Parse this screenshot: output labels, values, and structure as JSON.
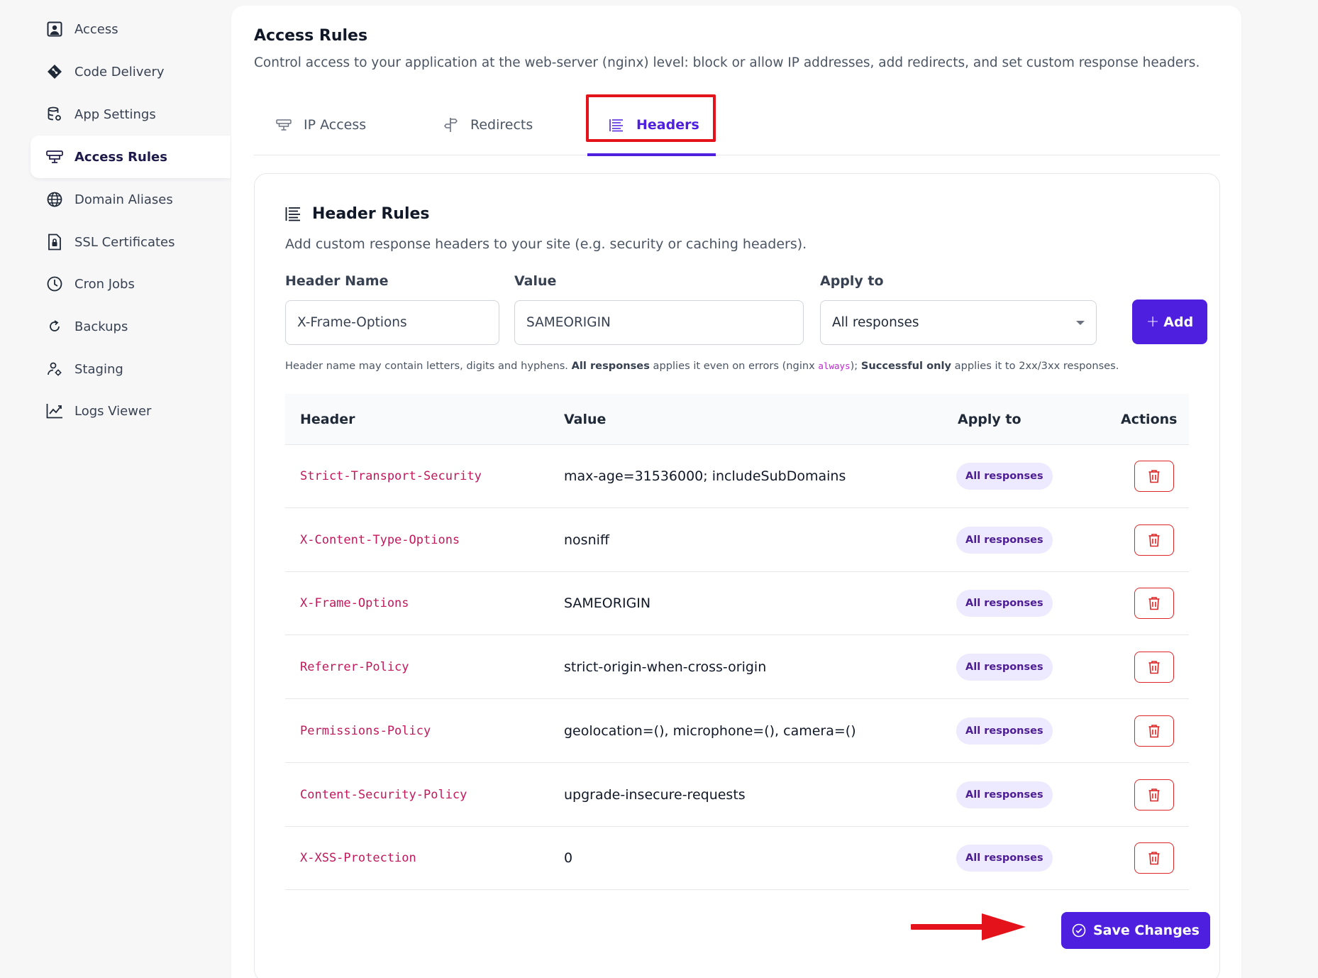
{
  "sidebar": {
    "items": [
      {
        "label": "Access",
        "icon": "user-square-icon"
      },
      {
        "label": "Code Delivery",
        "icon": "git-diamond-icon"
      },
      {
        "label": "App Settings",
        "icon": "database-gear-icon"
      },
      {
        "label": "Access Rules",
        "icon": "filter-rules-icon",
        "active": true
      },
      {
        "label": "Domain Aliases",
        "icon": "globe-icon"
      },
      {
        "label": "SSL Certificates",
        "icon": "lock-file-icon"
      },
      {
        "label": "Cron Jobs",
        "icon": "clock-icon"
      },
      {
        "label": "Backups",
        "icon": "refresh-icon"
      },
      {
        "label": "Staging",
        "icon": "user-gear-icon"
      },
      {
        "label": "Logs Viewer",
        "icon": "chart-line-icon"
      }
    ]
  },
  "page": {
    "title": "Access Rules",
    "subtitle": "Control access to your application at the web-server (nginx) level: block or allow IP addresses, add redirects, and set custom response headers."
  },
  "tabs": [
    {
      "label": "IP Access",
      "icon": "filter-icon"
    },
    {
      "label": "Redirects",
      "icon": "signpost-icon"
    },
    {
      "label": "Headers",
      "icon": "list-icon",
      "active": true
    }
  ],
  "card": {
    "title": "Header Rules",
    "subtitle": "Add custom response headers to your site (e.g. security or caching headers)."
  },
  "form": {
    "name_label": "Header Name",
    "name_value": "X-Frame-Options",
    "value_label": "Value",
    "value_value": "SAMEORIGIN",
    "apply_label": "Apply to",
    "apply_selected": "All responses",
    "add_label": "Add",
    "hint": {
      "part1": "Header name may contain letters, digits and hyphens. ",
      "bold1": "All responses",
      "part2": " applies it even on errors (nginx ",
      "code": "always",
      "part3": "); ",
      "bold2": "Successful only",
      "part4": " applies it to 2xx/3xx responses."
    }
  },
  "table": {
    "columns": [
      "Header",
      "Value",
      "Apply to",
      "Actions"
    ],
    "rows": [
      {
        "header": "Strict-Transport-Security",
        "value": "max-age=31536000; includeSubDomains",
        "apply": "All responses"
      },
      {
        "header": "X-Content-Type-Options",
        "value": "nosniff",
        "apply": "All responses"
      },
      {
        "header": "X-Frame-Options",
        "value": "SAMEORIGIN",
        "apply": "All responses"
      },
      {
        "header": "Referrer-Policy",
        "value": "strict-origin-when-cross-origin",
        "apply": "All responses"
      },
      {
        "header": "Permissions-Policy",
        "value": "geolocation=(), microphone=(), camera=()",
        "apply": "All responses"
      },
      {
        "header": "Content-Security-Policy",
        "value": "upgrade-insecure-requests",
        "apply": "All responses"
      },
      {
        "header": "X-XSS-Protection",
        "value": "0",
        "apply": "All responses"
      }
    ]
  },
  "save_label": "Save Changes",
  "colors": {
    "accent": "#4f1fe0",
    "header_code": "#c2185b",
    "danger": "#dc2626",
    "annotation_red": "#e3121b"
  }
}
